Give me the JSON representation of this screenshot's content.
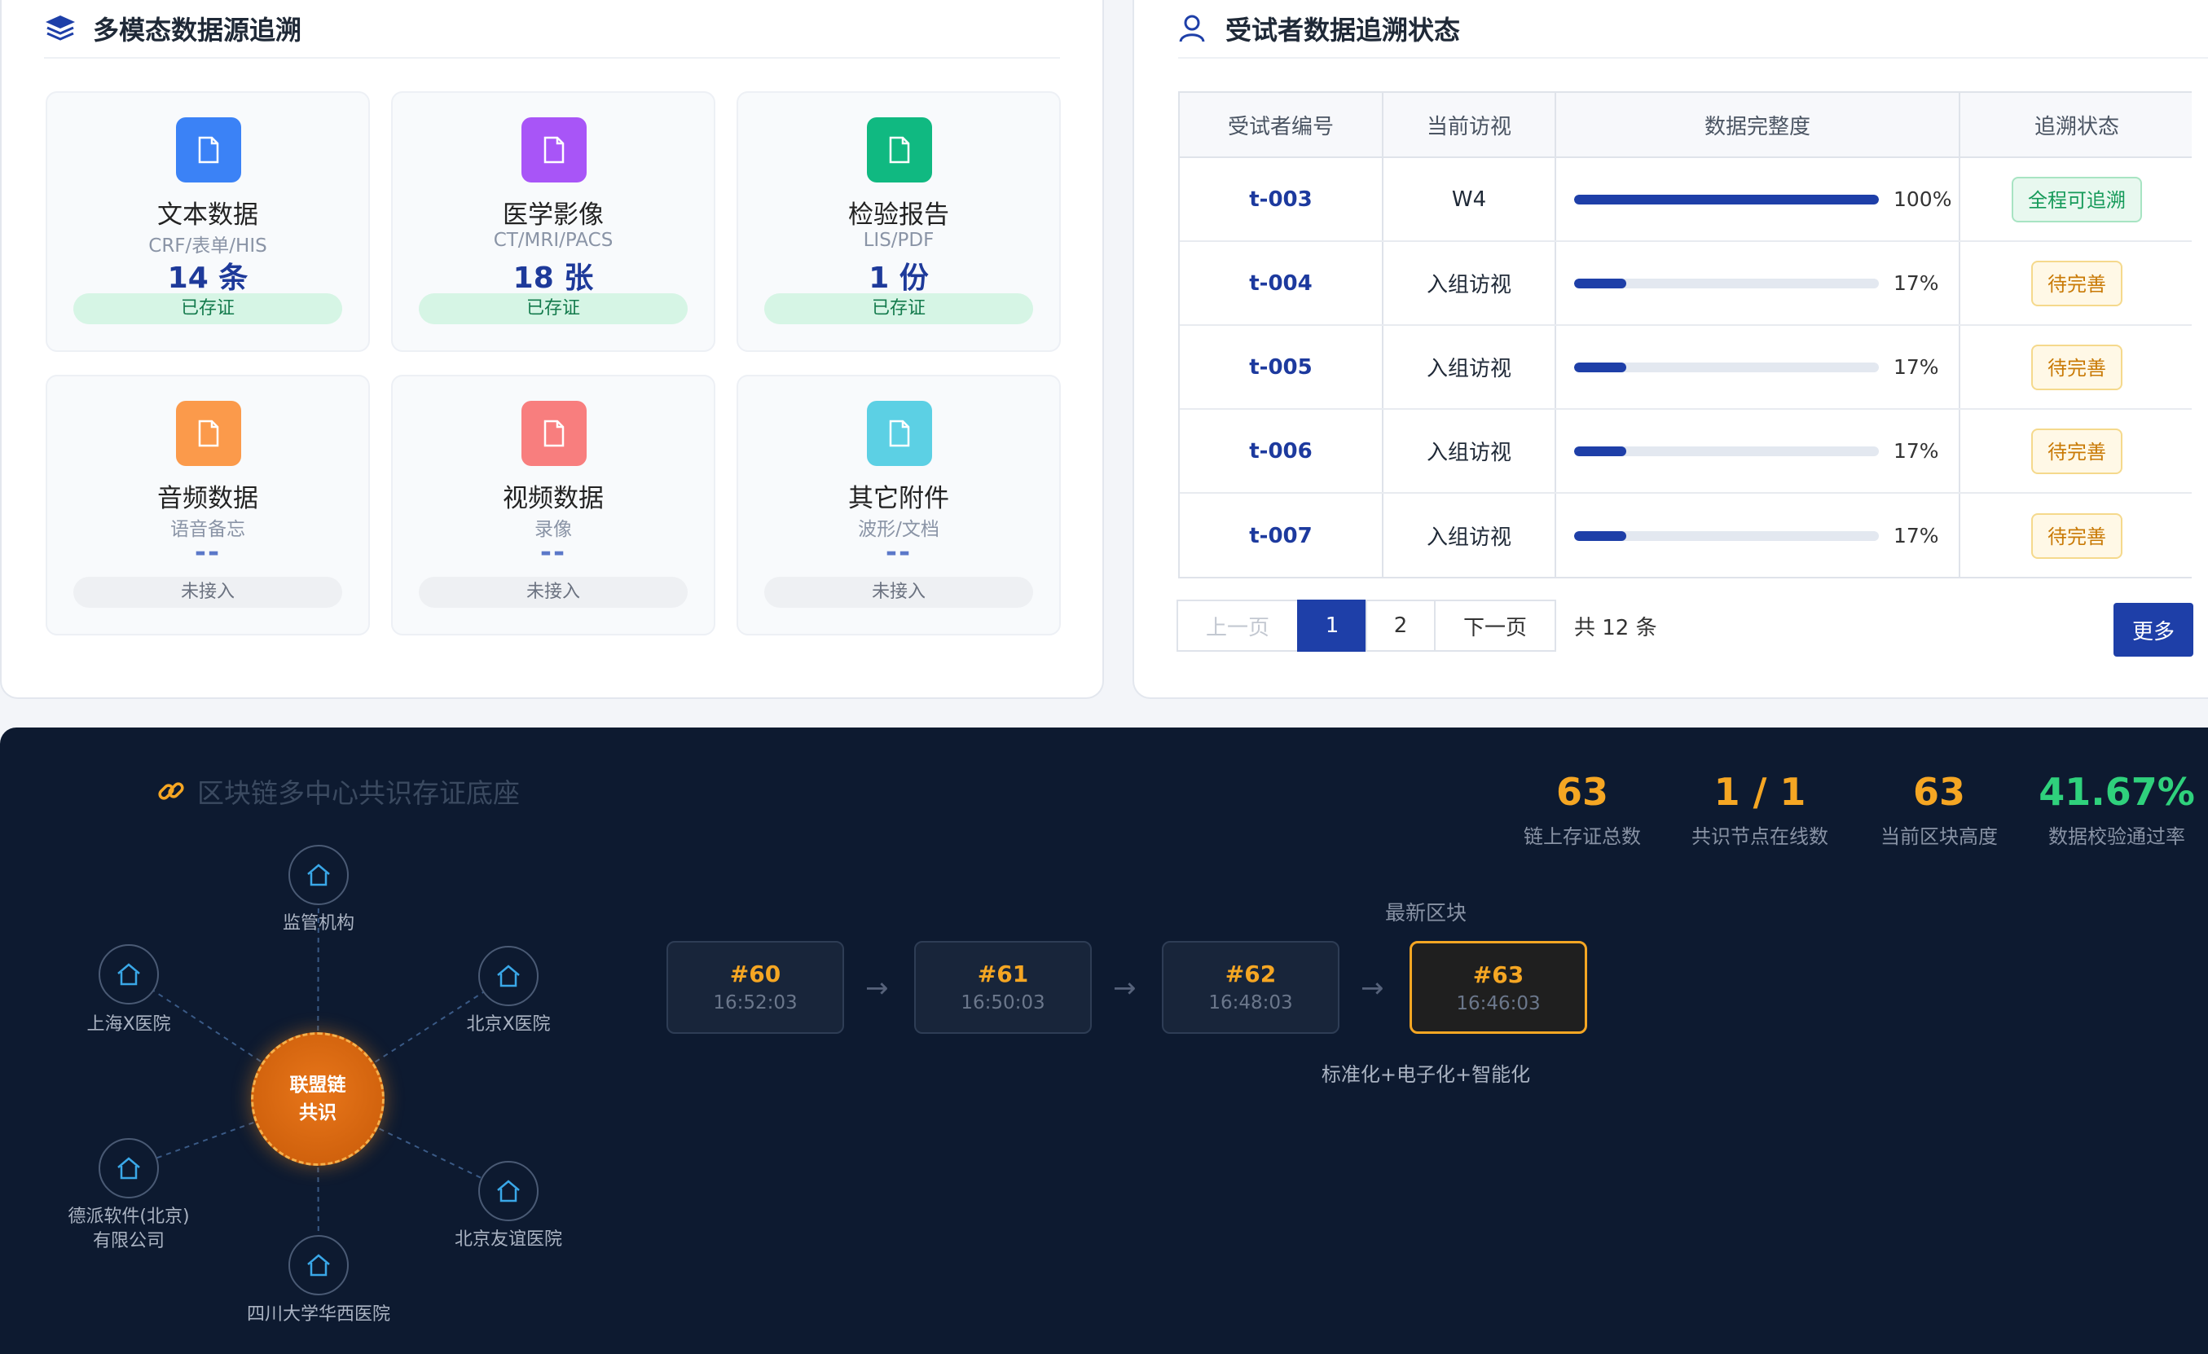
{
  "sources_panel": {
    "title": "多模态数据源追溯",
    "cards": [
      {
        "title": "文本数据",
        "sub": "CRF/表单/HIS",
        "count": "14 条",
        "status": "已存证",
        "color": "#3b82f6"
      },
      {
        "title": "医学影像",
        "sub": "CT/MRI/PACS",
        "count": "18 张",
        "status": "已存证",
        "color": "#a855f7"
      },
      {
        "title": "检验报告",
        "sub": "LIS/PDF",
        "count": "1 份",
        "status": "已存证",
        "color": "#10b981"
      },
      {
        "title": "音频数据",
        "sub": "语音备忘",
        "count": "--",
        "status": "未接入",
        "color": "#fb9a4b"
      },
      {
        "title": "视频数据",
        "sub": "录像",
        "count": "--",
        "status": "未接入",
        "color": "#f87e7e"
      },
      {
        "title": "其它附件",
        "sub": "波形/文档",
        "count": "--",
        "status": "未接入",
        "color": "#5cd0e4"
      }
    ]
  },
  "subjects_panel": {
    "title": "受试者数据追溯状态",
    "columns": [
      "受试者编号",
      "当前访视",
      "数据完整度",
      "追溯状态"
    ],
    "rows": [
      {
        "id": "t-003",
        "visit": "W4",
        "completeness": 100,
        "completeness_label": "100%",
        "status": "全程可追溯",
        "status_kind": "full"
      },
      {
        "id": "t-004",
        "visit": "入组访视",
        "completeness": 17,
        "completeness_label": "17%",
        "status": "待完善",
        "status_kind": "pending"
      },
      {
        "id": "t-005",
        "visit": "入组访视",
        "completeness": 17,
        "completeness_label": "17%",
        "status": "待完善",
        "status_kind": "pending"
      },
      {
        "id": "t-006",
        "visit": "入组访视",
        "completeness": 17,
        "completeness_label": "17%",
        "status": "待完善",
        "status_kind": "pending"
      },
      {
        "id": "t-007",
        "visit": "入组访视",
        "completeness": 17,
        "completeness_label": "17%",
        "status": "待完善",
        "status_kind": "pending"
      }
    ],
    "pagination": {
      "prev": "上一页",
      "pages": [
        "1",
        "2"
      ],
      "current": "1",
      "next": "下一页",
      "total": "共 12 条"
    },
    "more_button": "更多"
  },
  "chain": {
    "title": "区块链多中心共识存证底座",
    "stats": [
      {
        "value": "63",
        "label": "链上存证总数"
      },
      {
        "value": "1 / 1",
        "label": "共识节点在线数"
      },
      {
        "value": "63",
        "label": "当前区块高度"
      },
      {
        "value": "41.67%",
        "label": "数据校验通过率"
      }
    ],
    "hub": {
      "line1": "联盟链",
      "line2": "共识"
    },
    "nodes": [
      {
        "label": "监管机构"
      },
      {
        "label": "北京X医院"
      },
      {
        "label": "北京友谊医院"
      },
      {
        "label": "四川大学华西医院"
      },
      {
        "label": "德派软件(北京)有限公司"
      },
      {
        "label": "上海X医院"
      }
    ],
    "latest_label": "最新区块",
    "latest_sub": "标准化+电子化+智能化",
    "blocks": [
      {
        "num": "#60",
        "time": "16:52:03"
      },
      {
        "num": "#61",
        "time": "16:50:03"
      },
      {
        "num": "#62",
        "time": "16:48:03"
      },
      {
        "num": "#63",
        "time": "16:46:03"
      }
    ],
    "arrow": "→"
  }
}
